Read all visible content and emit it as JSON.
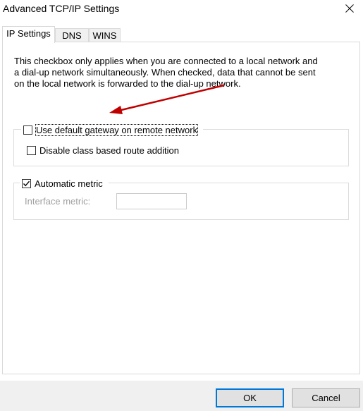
{
  "window": {
    "title": "Advanced TCP/IP Settings",
    "close_icon": "close-icon"
  },
  "tabs": [
    {
      "label": "IP Settings",
      "active": true
    },
    {
      "label": "DNS",
      "active": false
    },
    {
      "label": "WINS",
      "active": false
    }
  ],
  "main": {
    "description": "This checkbox only applies when you are connected to a local network and a dial-up network simultaneously.  When checked, data that cannot be sent on the local network is forwarded to the dial-up network.",
    "gateway_group": {
      "use_default_gateway_label": "Use default gateway on remote network",
      "use_default_gateway_checked": false,
      "disable_class_route_label": "Disable class based route addition",
      "disable_class_route_checked": false
    },
    "metric_group": {
      "automatic_metric_label": "Automatic metric",
      "automatic_metric_checked": true,
      "interface_metric_label": "Interface metric:",
      "interface_metric_value": ""
    }
  },
  "buttons": {
    "ok_label": "OK",
    "cancel_label": "Cancel"
  },
  "colors": {
    "accent": "#0078d7",
    "annotation_arrow": "#c00000",
    "button_bar": "#f0f0f0"
  }
}
